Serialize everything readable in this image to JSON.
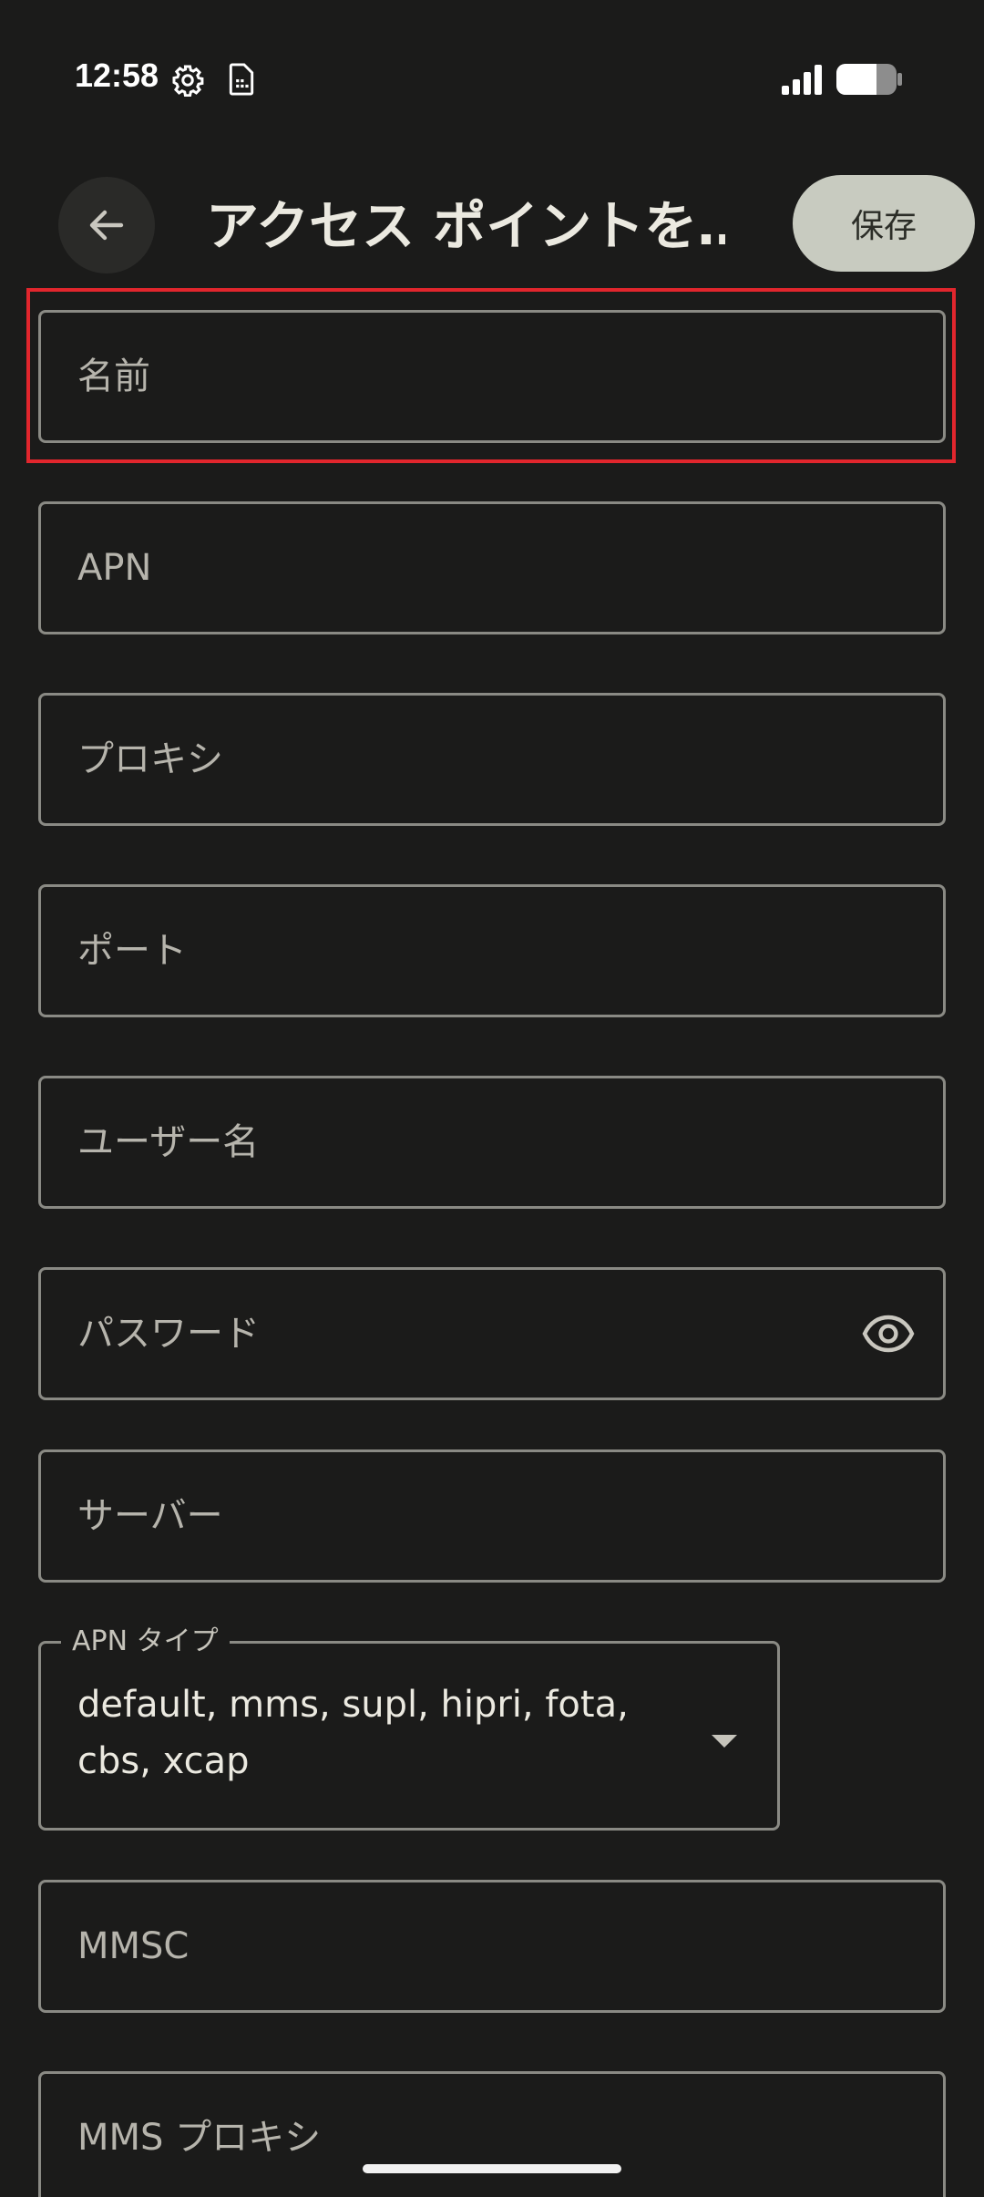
{
  "status_bar": {
    "time": "12:58",
    "icons": [
      "gear-icon",
      "sim-card-icon",
      "signal-icon",
      "battery-icon"
    ]
  },
  "app_bar": {
    "title": "アクセス ポイントを…",
    "save_label": "保存",
    "back_icon": "arrow-left-icon"
  },
  "fields": {
    "name": "名前",
    "apn": "APN",
    "proxy": "プロキシ",
    "port": "ポート",
    "username": "ユーザー名",
    "password": "パスワード",
    "server": "サーバー",
    "mmsc": "MMSC",
    "mms_proxy": "MMS プロキシ"
  },
  "apn_type": {
    "label": "APN タイプ",
    "value_line1": "default, mms, supl, hipri, fota,",
    "value_line2": "cbs, xcap"
  },
  "colors": {
    "background": "#1b1b1a",
    "accent_button": "#c8cbc0",
    "highlight": "#e2262d"
  }
}
